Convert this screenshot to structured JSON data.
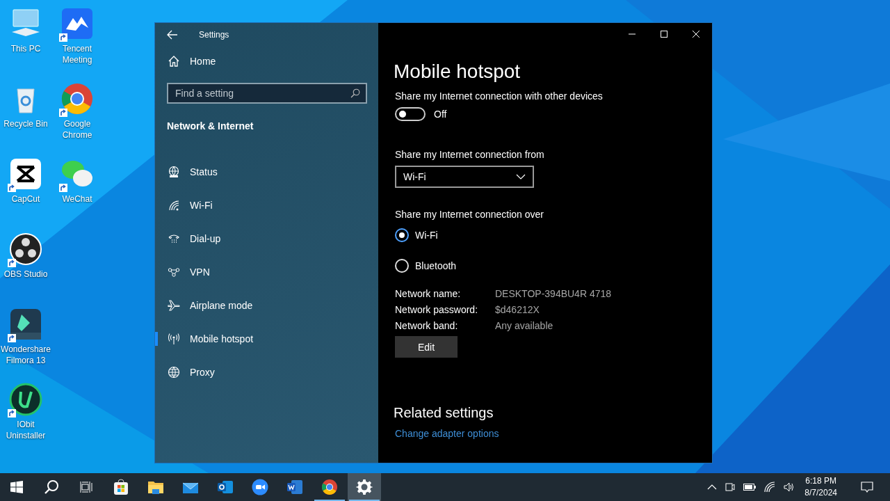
{
  "desktop_icons": [
    {
      "label": "This PC",
      "shortcut": false
    },
    {
      "label": "Tencent Meeting",
      "shortcut": true
    },
    {
      "label": "Recycle Bin",
      "shortcut": false
    },
    {
      "label": "Google Chrome",
      "shortcut": true
    },
    {
      "label": "CapCut",
      "shortcut": true
    },
    {
      "label": "WeChat",
      "shortcut": true
    },
    {
      "label": "OBS Studio",
      "shortcut": true
    },
    {
      "label": "Wondershare Filmora 13",
      "shortcut": true
    },
    {
      "label": "IObit Uninstaller",
      "shortcut": true
    }
  ],
  "window": {
    "title": "Settings"
  },
  "sidebar": {
    "home": "Home",
    "search": {
      "placeholder": "Find a setting"
    },
    "section": "Network & Internet",
    "items": [
      {
        "label": "Status",
        "selected": false
      },
      {
        "label": "Wi-Fi",
        "selected": false
      },
      {
        "label": "Dial-up",
        "selected": false
      },
      {
        "label": "VPN",
        "selected": false
      },
      {
        "label": "Airplane mode",
        "selected": false
      },
      {
        "label": "Mobile hotspot",
        "selected": true
      },
      {
        "label": "Proxy",
        "selected": false
      }
    ]
  },
  "content": {
    "title": "Mobile hotspot",
    "share_label": "Share my Internet connection with other devices",
    "share_toggle": {
      "on": false,
      "text": "Off"
    },
    "from_label": "Share my Internet connection from",
    "from_value": "Wi-Fi",
    "over_label": "Share my Internet connection over",
    "over_options": [
      {
        "label": "Wi-Fi",
        "selected": true
      },
      {
        "label": "Bluetooth",
        "selected": false
      }
    ],
    "properties": [
      {
        "name": "Network name:",
        "value": "DESKTOP-394BU4R 4718"
      },
      {
        "name": "Network password:",
        "value": "$d46212X"
      },
      {
        "name": "Network band:",
        "value": "Any available"
      }
    ],
    "edit_button": "Edit",
    "related_title": "Related settings",
    "related_link": "Change adapter options"
  },
  "taskbar": {
    "apps": [
      {
        "running": false,
        "active": false
      },
      {
        "running": false,
        "active": false
      },
      {
        "running": false,
        "active": false
      },
      {
        "running": false,
        "active": false
      },
      {
        "running": false,
        "active": false
      },
      {
        "running": false,
        "active": false
      },
      {
        "running": true,
        "active": false
      },
      {
        "running": true,
        "active": true
      }
    ],
    "time": "6:18 PM",
    "date": "8/7/2024"
  }
}
